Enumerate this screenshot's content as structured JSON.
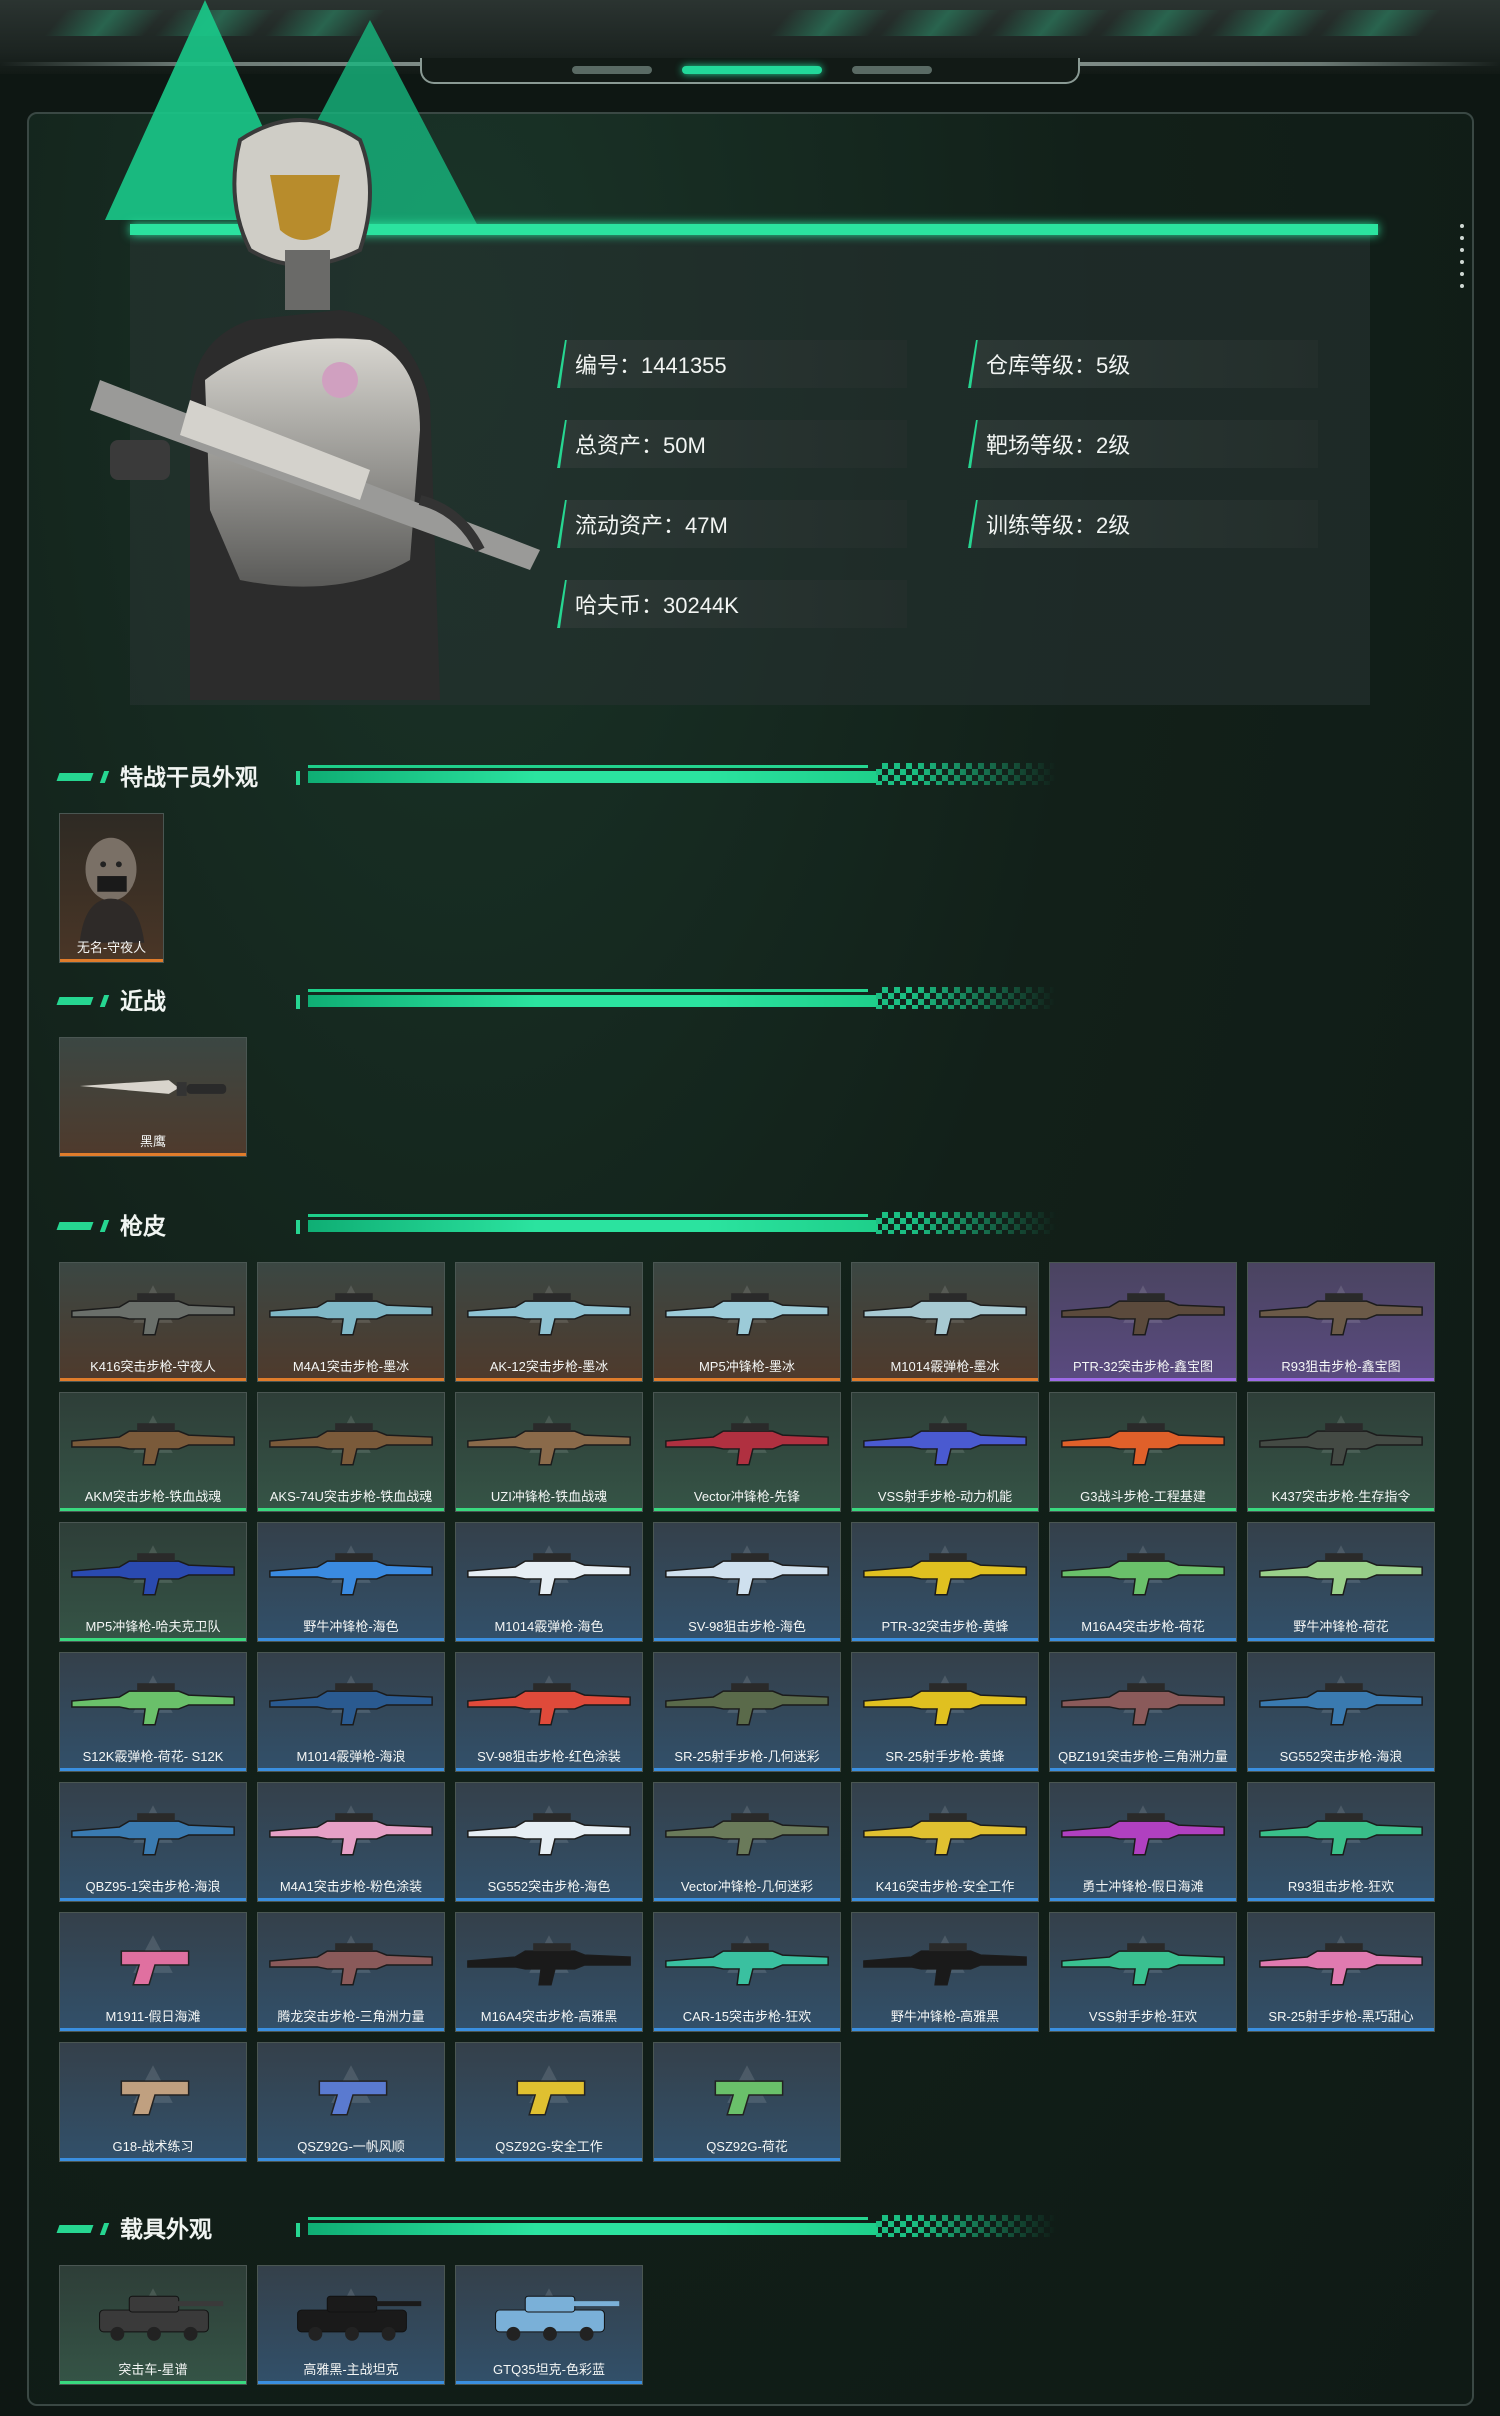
{
  "stats": {
    "id": "编号：1441355",
    "total_assets": "总资产：50M",
    "liquid_assets": "流动资产：47M",
    "hafu_coin": "哈夫币：30244K",
    "warehouse_level": "仓库等级：5级",
    "range_level": "靶场等级：2级",
    "training_level": "训练等级：2级"
  },
  "sections": {
    "operator": "特战干员外观",
    "melee": "近战",
    "gun_skins": "枪皮",
    "vehicles": "载具外观"
  },
  "operator_items": [
    {
      "name": "无名-守夜人",
      "rarity": "orange"
    }
  ],
  "melee_items": [
    {
      "name": "黑鹰",
      "rarity": "orange"
    }
  ],
  "gun_items": [
    {
      "name": "K416突击步枪-守夜人",
      "rarity": "orange",
      "color": "#6a6f6a"
    },
    {
      "name": "M4A1突击步枪-墨冰",
      "rarity": "orange",
      "color": "#7fb7c6"
    },
    {
      "name": "AK-12突击步枪-墨冰",
      "rarity": "orange",
      "color": "#8fc3d3"
    },
    {
      "name": "MP5冲锋枪-墨冰",
      "rarity": "orange",
      "color": "#9ccbd8"
    },
    {
      "name": "M1014霰弹枪-墨冰",
      "rarity": "orange",
      "color": "#a7c9d2"
    },
    {
      "name": "PTR-32突击步枪-鑫宝图",
      "rarity": "purple",
      "color": "#5b4a3c"
    },
    {
      "name": "R93狙击步枪-鑫宝图",
      "rarity": "purple",
      "color": "#6b5a48"
    },
    {
      "name": "AKM突击步枪-铁血战魂",
      "rarity": "green",
      "color": "#7a5a3a"
    },
    {
      "name": "AKS-74U突击步枪-铁血战魂",
      "rarity": "green",
      "color": "#7a5a3a"
    },
    {
      "name": "UZI冲锋枪-铁血战魂",
      "rarity": "green",
      "color": "#8a6a4a"
    },
    {
      "name": "Vector冲锋枪-先锋",
      "rarity": "green",
      "color": "#b03040"
    },
    {
      "name": "VSS射手步枪-动力机能",
      "rarity": "green",
      "color": "#4a5ad0"
    },
    {
      "name": "G3战斗步枪-工程基建",
      "rarity": "green",
      "color": "#e0602a"
    },
    {
      "name": "K437突击步枪-生存指令",
      "rarity": "green",
      "color": "#444a44"
    },
    {
      "name": "MP5冲锋枪-哈夫克卫队",
      "rarity": "green",
      "color": "#2a4ab0"
    },
    {
      "name": "野牛冲锋枪-海色",
      "rarity": "blue",
      "color": "#3a8ae0"
    },
    {
      "name": "M1014霰弹枪-海色",
      "rarity": "blue",
      "color": "#e6eef4"
    },
    {
      "name": "SV-98狙击步枪-海色",
      "rarity": "blue",
      "color": "#cfe0ee"
    },
    {
      "name": "PTR-32突击步枪-黄蜂",
      "rarity": "blue",
      "color": "#e0c020"
    },
    {
      "name": "M16A4突击步枪-荷花",
      "rarity": "blue",
      "color": "#6ac06a"
    },
    {
      "name": "野牛冲锋枪-荷花",
      "rarity": "blue",
      "color": "#9ad08a"
    },
    {
      "name": "S12K霰弹枪-荷花- S12K",
      "rarity": "blue",
      "color": "#6ac06a"
    },
    {
      "name": "M1014霰弹枪-海浪",
      "rarity": "blue",
      "color": "#2a5a90"
    },
    {
      "name": "SV-98狙击步枪-红色涂装",
      "rarity": "blue",
      "color": "#e04a3a"
    },
    {
      "name": "SR-25射手步枪-几何迷彩",
      "rarity": "blue",
      "color": "#5a6a4a"
    },
    {
      "name": "SR-25射手步枪-黄蜂",
      "rarity": "blue",
      "color": "#e0c020"
    },
    {
      "name": "QBZ191突击步枪-三角洲力量",
      "rarity": "blue",
      "color": "#8a5a5a"
    },
    {
      "name": "SG552突击步枪-海浪",
      "rarity": "blue",
      "color": "#3a7ab0"
    },
    {
      "name": "QBZ95-1突击步枪-海浪",
      "rarity": "blue",
      "color": "#3a7ab0"
    },
    {
      "name": "M4A1突击步枪-粉色涂装",
      "rarity": "blue",
      "color": "#e6a0c6"
    },
    {
      "name": "SG552突击步枪-海色",
      "rarity": "blue",
      "color": "#e6eef4"
    },
    {
      "name": "Vector冲锋枪-几何迷彩",
      "rarity": "blue",
      "color": "#6a7a5a"
    },
    {
      "name": "K416突击步枪-安全工作",
      "rarity": "blue",
      "color": "#e0c030"
    },
    {
      "name": "勇士冲锋枪-假日海滩",
      "rarity": "blue",
      "color": "#b040c0"
    },
    {
      "name": "R93狙击步枪-狂欢",
      "rarity": "blue",
      "color": "#3ac08a"
    },
    {
      "name": "M1911-假日海滩",
      "rarity": "blue",
      "color": "#e070a0"
    },
    {
      "name": "腾龙突击步枪-三角洲力量",
      "rarity": "blue",
      "color": "#8a5a5a"
    },
    {
      "name": "M16A4突击步枪-高雅黑",
      "rarity": "blue",
      "color": "#1a1a1a"
    },
    {
      "name": "CAR-15突击步枪-狂欢",
      "rarity": "blue",
      "color": "#3ac0a0"
    },
    {
      "name": "野牛冲锋枪-高雅黑",
      "rarity": "blue",
      "color": "#1a1a1a"
    },
    {
      "name": "VSS射手步枪-狂欢",
      "rarity": "blue",
      "color": "#3ac090"
    },
    {
      "name": "SR-25射手步枪-黑巧甜心",
      "rarity": "blue",
      "color": "#e07ab0"
    },
    {
      "name": "G18-战术练习",
      "rarity": "blue",
      "color": "#c0a080"
    },
    {
      "name": "QSZ92G-一帆风顺",
      "rarity": "blue",
      "color": "#5a7ad0"
    },
    {
      "name": "QSZ92G-安全工作",
      "rarity": "blue",
      "color": "#e0c030"
    },
    {
      "name": "QSZ92G-荷花",
      "rarity": "blue",
      "color": "#6ac06a"
    }
  ],
  "vehicle_items": [
    {
      "name": "突击车-星谱",
      "rarity": "green",
      "color": "#3a3a3a"
    },
    {
      "name": "高雅黑-主战坦克",
      "rarity": "blue",
      "color": "#1a1a1a"
    },
    {
      "name": "GTQ35坦克-色彩蓝",
      "rarity": "blue",
      "color": "#7ab0d8"
    }
  ]
}
